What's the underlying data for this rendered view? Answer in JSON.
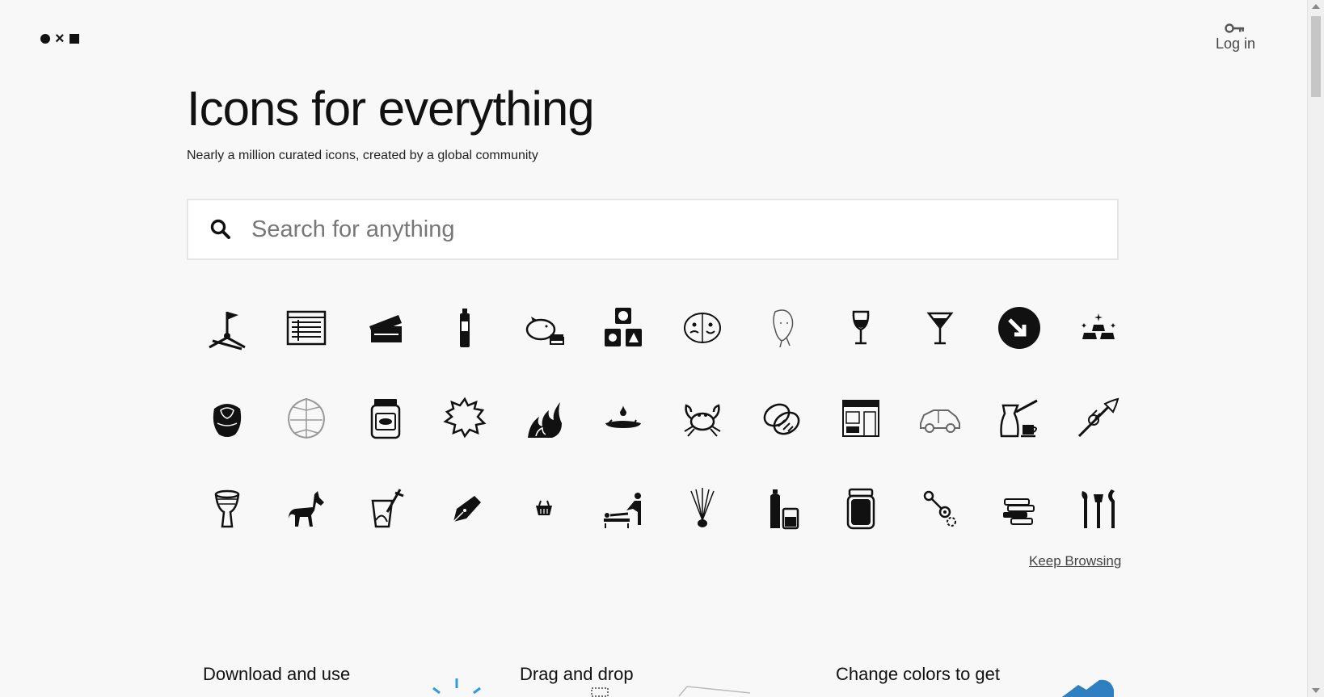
{
  "header": {
    "login_label": "Log in",
    "login_icon": "key-icon",
    "logo_icon": "dot-cross-square-logo"
  },
  "hero": {
    "title": "Icons for everything",
    "subtitle": "Nearly a million curated icons, created by a global community"
  },
  "search": {
    "placeholder": "Search for anything",
    "value": "",
    "icon": "search-icon"
  },
  "icons": [
    {
      "name": "flag-on-pole-icon"
    },
    {
      "name": "spreadsheet-window-icon"
    },
    {
      "name": "ticket-icon"
    },
    {
      "name": "bottle-icon"
    },
    {
      "name": "piggy-bank-icon"
    },
    {
      "name": "shape-blocks-icon"
    },
    {
      "name": "theater-masks-icon"
    },
    {
      "name": "woman-face-icon"
    },
    {
      "name": "wine-glass-icon"
    },
    {
      "name": "martini-glass-icon"
    },
    {
      "name": "arrow-circle-icon"
    },
    {
      "name": "gold-bars-icon"
    },
    {
      "name": "rose-icon"
    },
    {
      "name": "monstera-leaf-icon"
    },
    {
      "name": "jar-icon"
    },
    {
      "name": "speech-burst-icon"
    },
    {
      "name": "fire-icon"
    },
    {
      "name": "oil-spill-icon"
    },
    {
      "name": "crab-icon"
    },
    {
      "name": "bread-icon"
    },
    {
      "name": "storefront-icon"
    },
    {
      "name": "car-icon"
    },
    {
      "name": "coffee-pot-icon"
    },
    {
      "name": "trumpet-icon"
    },
    {
      "name": "djembe-drum-icon"
    },
    {
      "name": "horse-icon"
    },
    {
      "name": "blender-icon"
    },
    {
      "name": "pen-nib-icon"
    },
    {
      "name": "basket-icon"
    },
    {
      "name": "massage-icon"
    },
    {
      "name": "shuttlecock-icon"
    },
    {
      "name": "bottle-and-cup-icon"
    },
    {
      "name": "mason-jar-icon"
    },
    {
      "name": "key-ring-icon"
    },
    {
      "name": "stacked-books-icon"
    },
    {
      "name": "tools-icon"
    }
  ],
  "keep_browsing": "Keep Browsing",
  "features": [
    {
      "title": "Download and use"
    },
    {
      "title": "Drag and drop"
    },
    {
      "title": "Change colors to get"
    }
  ]
}
